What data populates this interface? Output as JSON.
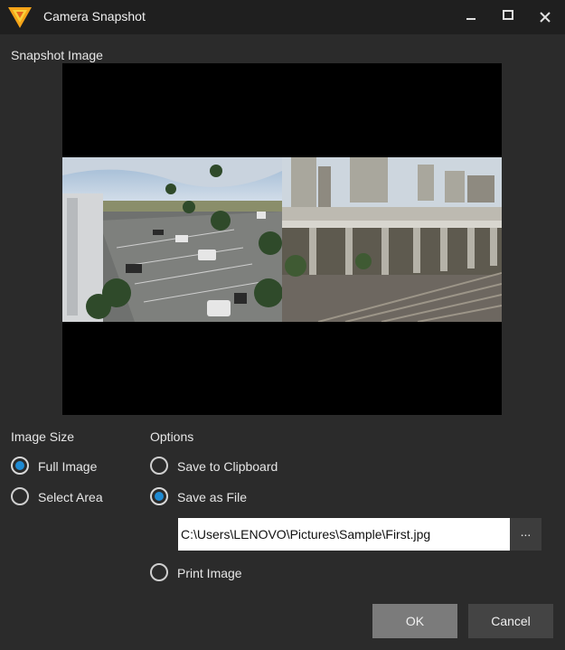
{
  "window": {
    "title": "Camera Snapshot",
    "accent_color": "#f7b018",
    "controls": {
      "minimize_icon": "minimize-icon",
      "maximize_icon": "maximize-icon",
      "close_icon": "close-icon"
    }
  },
  "snapshot": {
    "label": "Snapshot Image"
  },
  "image_size": {
    "label": "Image Size",
    "options": [
      {
        "label": "Full Image",
        "checked": true
      },
      {
        "label": "Select Area",
        "checked": false
      }
    ]
  },
  "options": {
    "label": "Options",
    "save_to_clipboard": {
      "label": "Save to Clipboard",
      "checked": false
    },
    "save_as_file": {
      "label": "Save as File",
      "checked": true,
      "path": "C:\\Users\\LENOVO\\Pictures\\Sample\\First.jpg",
      "browse_label": "..."
    },
    "print_image": {
      "label": "Print Image",
      "checked": false
    }
  },
  "buttons": {
    "ok": "OK",
    "cancel": "Cancel"
  },
  "colors": {
    "radio_selected": "#1f8ad2",
    "ok_button": "#7b7b7b",
    "cancel_button": "#444444"
  }
}
